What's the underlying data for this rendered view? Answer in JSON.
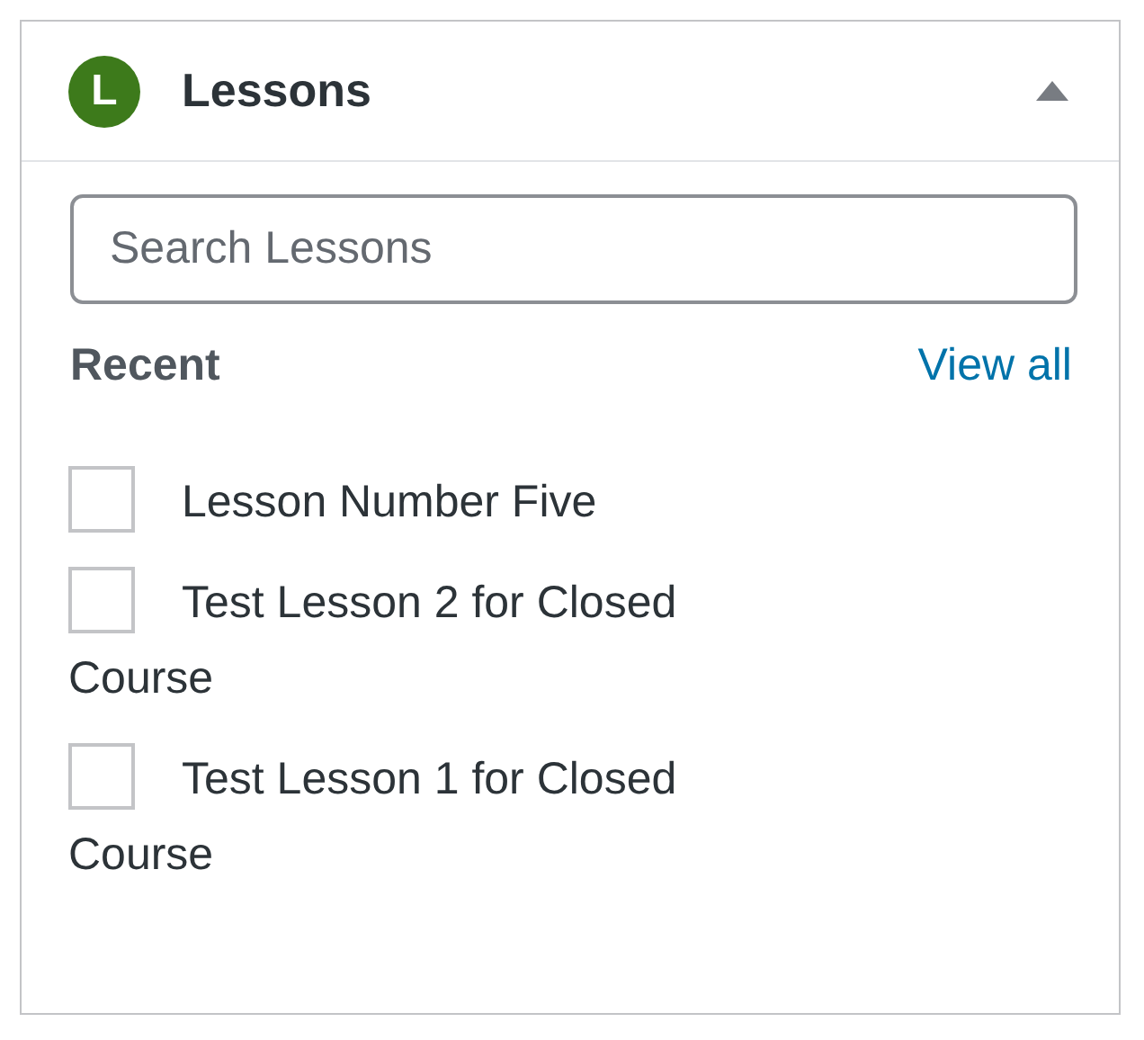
{
  "panel": {
    "logo": "L",
    "title": "Lessons",
    "expanded": true
  },
  "search": {
    "placeholder": "Search Lessons"
  },
  "section": {
    "heading": "Recent",
    "link": "View all"
  },
  "lessons": [
    {
      "label": "Lesson Number Five",
      "checked": false
    },
    {
      "label": "Test Lesson 2 for Closed Course",
      "checked": false
    },
    {
      "label": "Test Lesson 1 for Closed Course",
      "checked": false
    }
  ]
}
